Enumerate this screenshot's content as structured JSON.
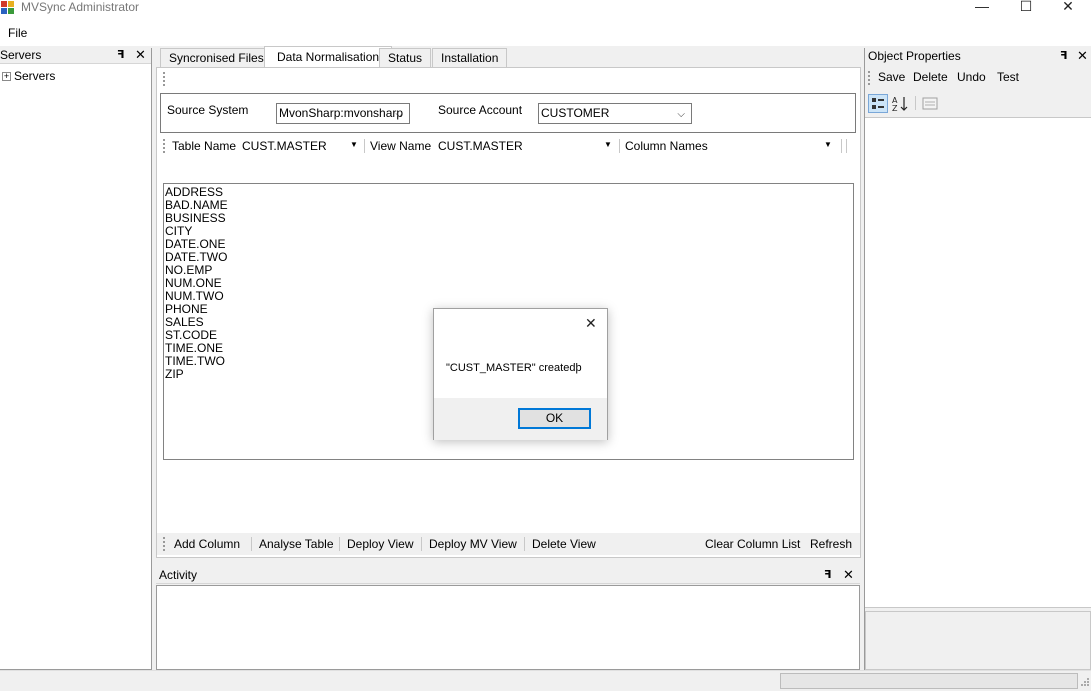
{
  "window": {
    "title": "MVSync Administrator",
    "controls": {
      "minimize": "—",
      "maximize": "☐",
      "close": "✕"
    }
  },
  "menu": {
    "file": "File"
  },
  "servers_panel": {
    "title": "Servers",
    "pin": "ꟻ",
    "close": "✕",
    "tree": [
      {
        "label": "Servers",
        "expander": "+"
      }
    ]
  },
  "tabs": [
    {
      "label": "Syncronised Files",
      "active": false
    },
    {
      "label": "Data Normalisation",
      "active": true
    },
    {
      "label": "Status",
      "active": false
    },
    {
      "label": "Installation",
      "active": false
    }
  ],
  "source": {
    "system_label": "Source System",
    "system_value": "MvonSharp:mvonsharp",
    "account_label": "Source Account",
    "account_value": "CUSTOMER"
  },
  "selectors": {
    "table_name_label": "Table Name",
    "table_name_value": "CUST.MASTER",
    "view_name_label": "View Name",
    "view_name_value": "CUST.MASTER",
    "column_names_label": "Column Names",
    "column_names_value": ""
  },
  "columns_list": [
    "ADDRESS",
    "BAD.NAME",
    "BUSINESS",
    "CITY",
    "DATE.ONE",
    "DATE.TWO",
    "NO.EMP",
    "NUM.ONE",
    "NUM.TWO",
    "PHONE",
    "SALES",
    "ST.CODE",
    "TIME.ONE",
    "TIME.TWO",
    "ZIP"
  ],
  "actions": {
    "add_column": "Add Column",
    "analyse_table": "Analyse Table",
    "deploy_view": "Deploy View",
    "deploy_mv_view": "Deploy MV View",
    "delete_view": "Delete View",
    "clear_column_list": "Clear Column List",
    "refresh": "Refresh"
  },
  "activity_panel": {
    "title": "Activity",
    "pin": "ꟻ",
    "close": "✕"
  },
  "object_properties": {
    "title": "Object Properties",
    "pin": "ꟻ",
    "close": "✕",
    "toolbar": {
      "save": "Save",
      "delete": "Delete",
      "undo": "Undo",
      "test": "Test"
    }
  },
  "dialog": {
    "message": "\"CUST_MASTER\" createdþ",
    "ok_label": "OK",
    "close": "✕"
  },
  "colors": {
    "accent": "#0078d7",
    "panel_bg": "#f0f0f0"
  }
}
